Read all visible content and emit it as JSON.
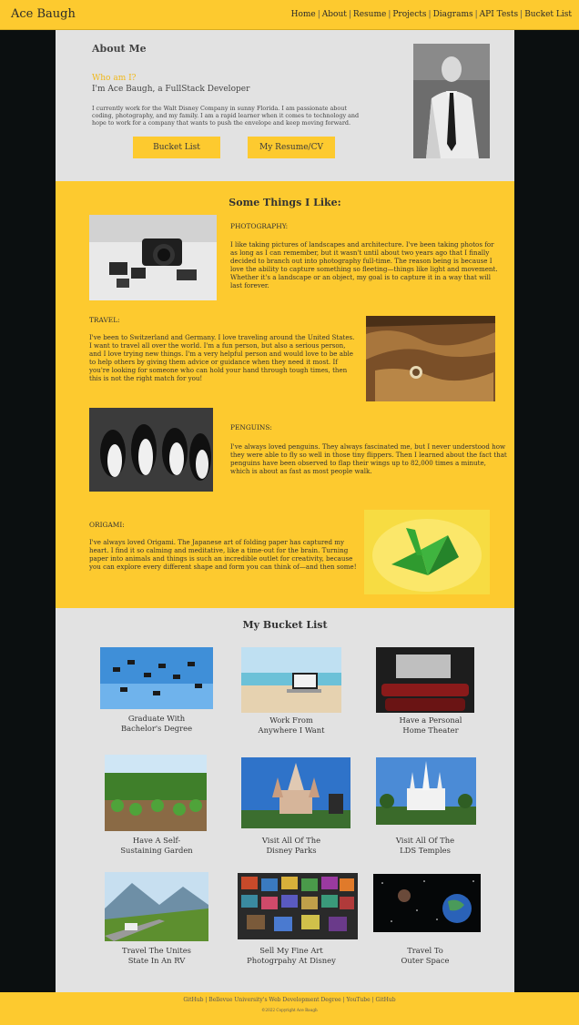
{
  "header": {
    "brand": "Ace Baugh",
    "nav": [
      "Home",
      "About",
      "Resume",
      "Projects",
      "Diagrams",
      "API Tests",
      "Bucket List"
    ]
  },
  "about": {
    "title": "About Me",
    "who": "Who am I?",
    "iam": "I'm Ace Baugh, a FullStack Developer",
    "text": "I currently work for the Walt Disney Company in sunny Florida. I am passionate about coding, photography, and my family. I am a rapid learner when it comes to technology and hope to work for a company that wants to push the envelope and keep moving forward.",
    "button_bucket": "Bucket List",
    "button_resume": "My Resume/CV"
  },
  "likes": {
    "title": "Some Things I Like:",
    "sections": [
      {
        "heading": "PHOTOGRAPHY:",
        "text": "I like taking pictures of landscapes and architecture. I've been taking photos for as long as I can remember, but it wasn't until about two years ago that I finally decided to branch out into photography full-time. The reason being is because I love the ability to capture something so fleeting—things like light and movement. Whether it's a landscape or an object, my goal is to capture it in a way that will last forever."
      },
      {
        "heading": "TRAVEL:",
        "text": "I've been to Switzerland and Germany. I love traveling around the United States. I want to travel all over the world. I'm a fun person, but also a serious person, and I love trying new things. I'm a very helpful person and would love to be able to help others by giving them advice or guidance when they need it most. If you're looking for someone who can hold your hand through tough times, then this is not the right match for you!"
      },
      {
        "heading": "PENGUINS:",
        "text": "I've always loved penguins. They always fascinated me, but I never understood how they were able to fly so well in those tiny flippers. Then I learned about the fact that penguins have been observed to flap their wings up to 82,000 times a minute, which is about as fast as most people walk."
      },
      {
        "heading": "ORIGAMI:",
        "text": "I've always loved Origami. The Japanese art of folding paper has captured my heart. I find it so calming and meditative, like a time-out for the brain. Turning paper into animals and things is such an incredible outlet for creativity, because you can explore every different shape and form you can think of—and then some!"
      }
    ]
  },
  "bucket": {
    "title": "My Bucket List",
    "items": [
      {
        "line1": "Graduate With",
        "line2": "Bachelor's Degree"
      },
      {
        "line1": "Work From",
        "line2": "Anywhere I Want"
      },
      {
        "line1": "Have a Personal",
        "line2": "Home Theater"
      },
      {
        "line1": "Have A Self-",
        "line2": "Sustaining Garden"
      },
      {
        "line1": "Visit All Of The",
        "line2": "Disney Parks"
      },
      {
        "line1": "Visit All Of The",
        "line2": "LDS Temples"
      },
      {
        "line1": "Travel The Unites",
        "line2": "State In An RV"
      },
      {
        "line1": "Sell My Fine Art",
        "line2": "Photogrpahy At Disney"
      },
      {
        "line1": "Travel To",
        "line2": "Outer Space"
      }
    ]
  },
  "footer": {
    "links": [
      "GitHub",
      "Bellevue University's Web Development Degree",
      "YouTube",
      "GitHub"
    ],
    "copyright": "©2022 Copyright Ace Baugh"
  },
  "colors": {
    "accent": "#fdca2f",
    "panel": "#e2e2e2",
    "page_bg": "#0b0f10"
  }
}
